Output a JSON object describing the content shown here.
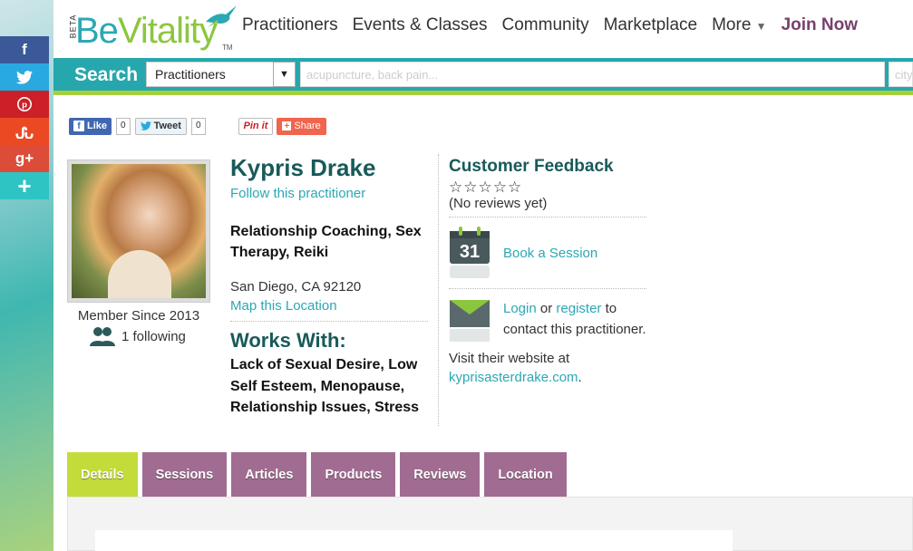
{
  "social": {
    "facebook": "f",
    "twitter": "t",
    "pinterest": "P",
    "stumbleupon": "su",
    "googleplus": "g+",
    "more": "+"
  },
  "header": {
    "logo_beta": "BETA",
    "logo_be": "Be",
    "logo_vitality": "Vitality",
    "logo_tm": "TM",
    "nav": [
      "Practitioners",
      "Events & Classes",
      "Community",
      "Marketplace",
      "More"
    ],
    "join": "Join Now"
  },
  "search": {
    "label": "Search",
    "category_selected": "Practitioners",
    "keyword_placeholder": "acupuncture, back pain...",
    "location_placeholder": "city"
  },
  "share": {
    "like_label": "Like",
    "like_count": "0",
    "tweet_label": "Tweet",
    "tweet_count": "0",
    "pin_label": "Pin it",
    "share_label": "Share"
  },
  "profile": {
    "member_since": "Member Since 2013",
    "following": "1 following",
    "name": "Kypris Drake",
    "follow_link": "Follow this practitioner",
    "specialties": "Relationship Coaching, Sex Therapy, Reiki",
    "address": "San Diego, CA 92120",
    "map_link": "Map this Location",
    "works_title": "Works With:",
    "works_list": "Lack of Sexual Desire, Low Self Esteem, Menopause, Relationship Issues, Stress"
  },
  "feedback": {
    "title": "Customer Feedback",
    "stars": "☆☆☆☆☆",
    "no_reviews": "(No reviews yet)",
    "calendar_day": "31",
    "book_link": "Book a Session",
    "login_link": "Login",
    "or_text": " or ",
    "register_link": "register",
    "to_contact": " to contact this practitioner.",
    "visit_text": "Visit their website at ",
    "website": "kyprisasterdrake.com",
    "period": "."
  },
  "tabs": [
    "Details",
    "Sessions",
    "Articles",
    "Products",
    "Reviews",
    "Location"
  ],
  "colors": {
    "teal": "#26a7ad",
    "lime": "#a6cf3a",
    "purple_tab": "#a16c91",
    "active_tab": "#c4dc3a",
    "dark_green_heading": "#195a5a",
    "link": "#2ba8b4"
  }
}
